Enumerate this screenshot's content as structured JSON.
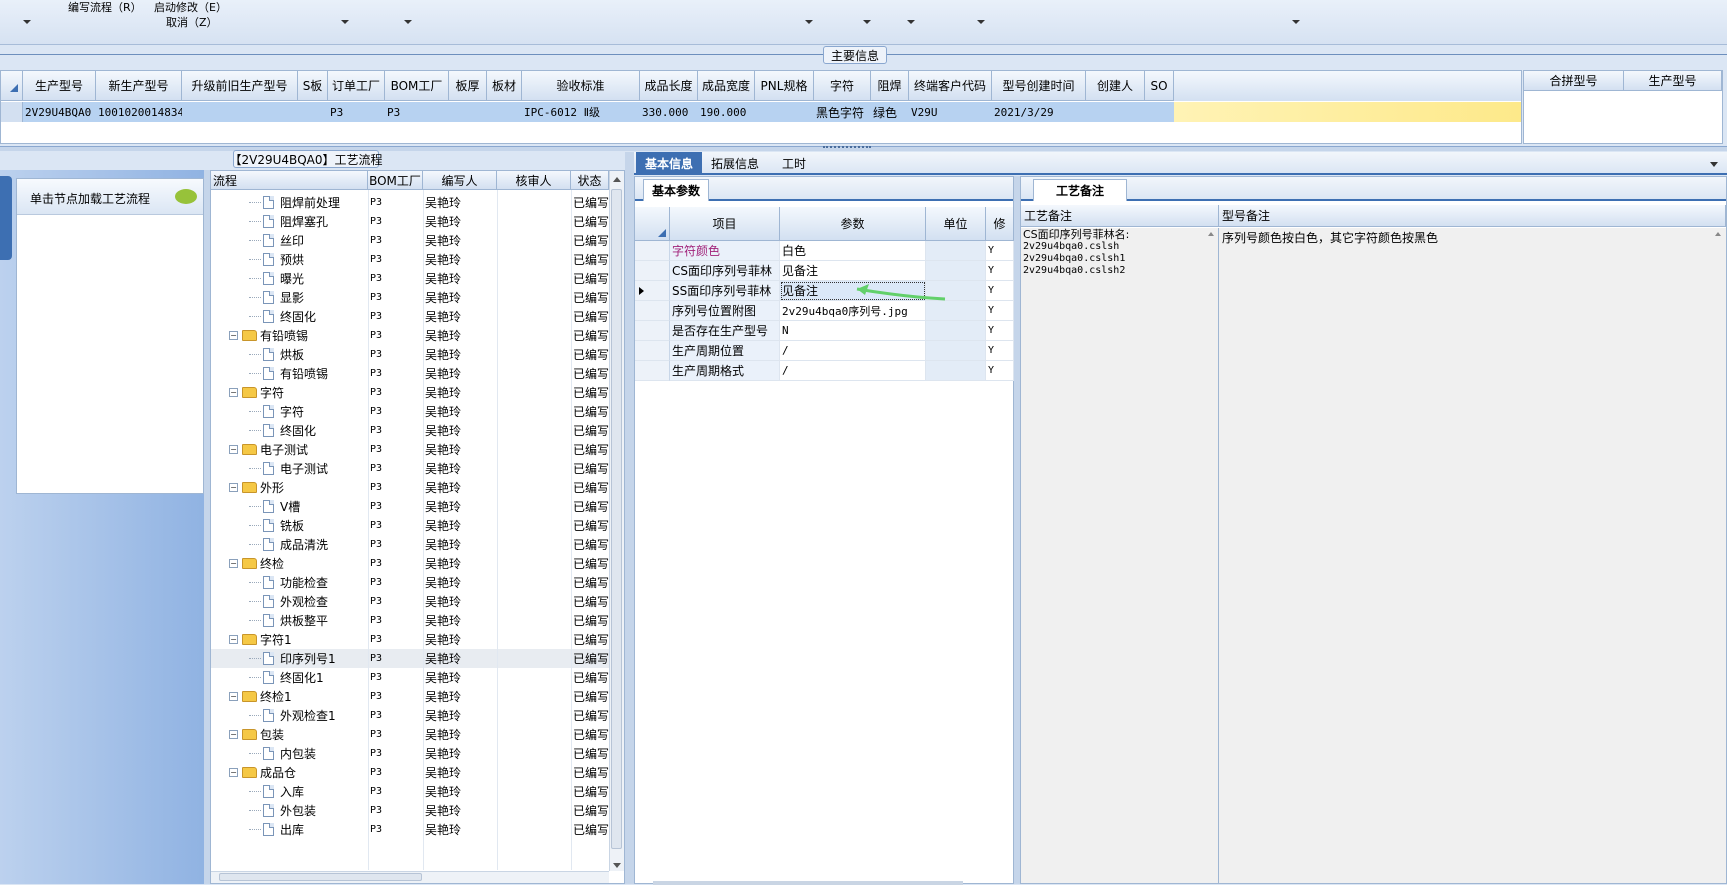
{
  "menu": {
    "edit_flow": "编写流程（R）",
    "start_modify": "启动修改（E）",
    "cancel": "取消（Z）"
  },
  "main_info_label": "主要信息",
  "main_grid": {
    "columns": [
      "生产型号",
      "新生产型号",
      "升级前旧生产型号",
      "S板",
      "订单工厂",
      "BOM工厂",
      "板厚",
      "板材",
      "验收标准",
      "成品长度",
      "成品宽度",
      "PNL规格",
      "字符",
      "阻焊",
      "终端客户代码",
      "型号创建时间",
      "创建人",
      "SO"
    ],
    "row": [
      "2V29U4BQA0",
      "10010200148343",
      "",
      "",
      "P3",
      "P3",
      "",
      "",
      "IPC-6012 Ⅱ级",
      "330.000",
      "190.000",
      "",
      "黑色字符",
      "绿色",
      "V29U",
      "2021/3/29",
      "",
      ""
    ]
  },
  "merge_grid": {
    "columns": [
      "合拼型号",
      "生产型号"
    ]
  },
  "left_panel": {
    "load_label": "单击节点加载工艺流程"
  },
  "flow_panel": {
    "title": "【2V29U4BQA0】工艺流程",
    "columns": [
      "流程",
      "BOM工厂",
      "编写人",
      "核审人",
      "状态"
    ],
    "rows": [
      {
        "type": "file",
        "name": "阻焊前处理",
        "bom": "P3",
        "writer": "吴艳玲",
        "reviewer": "",
        "status": "已编写"
      },
      {
        "type": "file",
        "name": "阻焊塞孔",
        "bom": "P3",
        "writer": "吴艳玲",
        "reviewer": "",
        "status": "已编写"
      },
      {
        "type": "file",
        "name": "丝印",
        "bom": "P3",
        "writer": "吴艳玲",
        "reviewer": "",
        "status": "已编写"
      },
      {
        "type": "file",
        "name": "预烘",
        "bom": "P3",
        "writer": "吴艳玲",
        "reviewer": "",
        "status": "已编写"
      },
      {
        "type": "file",
        "name": "曝光",
        "bom": "P3",
        "writer": "吴艳玲",
        "reviewer": "",
        "status": "已编写"
      },
      {
        "type": "file",
        "name": "显影",
        "bom": "P3",
        "writer": "吴艳玲",
        "reviewer": "",
        "status": "已编写"
      },
      {
        "type": "file",
        "name": "终固化",
        "bom": "P3",
        "writer": "吴艳玲",
        "reviewer": "",
        "status": "已编写"
      },
      {
        "type": "folder",
        "name": "有铅喷锡",
        "bom": "P3",
        "writer": "吴艳玲",
        "reviewer": "",
        "status": "已编写"
      },
      {
        "type": "file",
        "name": "烘板",
        "bom": "P3",
        "writer": "吴艳玲",
        "reviewer": "",
        "status": "已编写"
      },
      {
        "type": "file",
        "name": "有铅喷锡",
        "bom": "P3",
        "writer": "吴艳玲",
        "reviewer": "",
        "status": "已编写"
      },
      {
        "type": "folder",
        "name": "字符",
        "bom": "P3",
        "writer": "吴艳玲",
        "reviewer": "",
        "status": "已编写"
      },
      {
        "type": "file",
        "name": "字符",
        "bom": "P3",
        "writer": "吴艳玲",
        "reviewer": "",
        "status": "已编写"
      },
      {
        "type": "file",
        "name": "终固化",
        "bom": "P3",
        "writer": "吴艳玲",
        "reviewer": "",
        "status": "已编写"
      },
      {
        "type": "folder",
        "name": "电子测试",
        "bom": "P3",
        "writer": "吴艳玲",
        "reviewer": "",
        "status": "已编写"
      },
      {
        "type": "file",
        "name": "电子测试",
        "bom": "P3",
        "writer": "吴艳玲",
        "reviewer": "",
        "status": "已编写"
      },
      {
        "type": "folder",
        "name": "外形",
        "bom": "P3",
        "writer": "吴艳玲",
        "reviewer": "",
        "status": "已编写"
      },
      {
        "type": "file",
        "name": "V槽",
        "bom": "P3",
        "writer": "吴艳玲",
        "reviewer": "",
        "status": "已编写"
      },
      {
        "type": "file",
        "name": "铣板",
        "bom": "P3",
        "writer": "吴艳玲",
        "reviewer": "",
        "status": "已编写"
      },
      {
        "type": "file",
        "name": "成品清洗",
        "bom": "P3",
        "writer": "吴艳玲",
        "reviewer": "",
        "status": "已编写"
      },
      {
        "type": "folder",
        "name": "终检",
        "bom": "P3",
        "writer": "吴艳玲",
        "reviewer": "",
        "status": "已编写"
      },
      {
        "type": "file",
        "name": "功能检查",
        "bom": "P3",
        "writer": "吴艳玲",
        "reviewer": "",
        "status": "已编写"
      },
      {
        "type": "file",
        "name": "外观检查",
        "bom": "P3",
        "writer": "吴艳玲",
        "reviewer": "",
        "status": "已编写"
      },
      {
        "type": "file",
        "name": "烘板整平",
        "bom": "P3",
        "writer": "吴艳玲",
        "reviewer": "",
        "status": "已编写"
      },
      {
        "type": "folder",
        "name": "字符1",
        "bom": "P3",
        "writer": "吴艳玲",
        "reviewer": "",
        "status": "已编写"
      },
      {
        "type": "file",
        "name": "印序列号1",
        "bom": "P3",
        "writer": "吴艳玲",
        "reviewer": "",
        "status": "已编写",
        "selected": true
      },
      {
        "type": "file",
        "name": "终固化1",
        "bom": "P3",
        "writer": "吴艳玲",
        "reviewer": "",
        "status": "已编写"
      },
      {
        "type": "folder",
        "name": "终检1",
        "bom": "P3",
        "writer": "吴艳玲",
        "reviewer": "",
        "status": "已编写"
      },
      {
        "type": "file",
        "name": "外观检查1",
        "bom": "P3",
        "writer": "吴艳玲",
        "reviewer": "",
        "status": "已编写"
      },
      {
        "type": "folder",
        "name": "包装",
        "bom": "P3",
        "writer": "吴艳玲",
        "reviewer": "",
        "status": "已编写"
      },
      {
        "type": "file",
        "name": "内包装",
        "bom": "P3",
        "writer": "吴艳玲",
        "reviewer": "",
        "status": "已编写"
      },
      {
        "type": "folder",
        "name": "成品仓",
        "bom": "P3",
        "writer": "吴艳玲",
        "reviewer": "",
        "status": "已编写"
      },
      {
        "type": "file",
        "name": "入库",
        "bom": "P3",
        "writer": "吴艳玲",
        "reviewer": "",
        "status": "已编写"
      },
      {
        "type": "file",
        "name": "外包装",
        "bom": "P3",
        "writer": "吴艳玲",
        "reviewer": "",
        "status": "已编写"
      },
      {
        "type": "file",
        "name": "出库",
        "bom": "P3",
        "writer": "吴艳玲",
        "reviewer": "",
        "status": "已编写"
      }
    ]
  },
  "tabs": [
    "基本信息",
    "拓展信息",
    "工时"
  ],
  "params_panel": {
    "subtab": "基本参数",
    "columns": [
      "项目",
      "参数",
      "单位",
      "修"
    ],
    "rows": [
      {
        "item": "字符颜色",
        "value": "白色",
        "unit": "",
        "mod": "Y",
        "highlight": true
      },
      {
        "item": "CS面印序列号菲林",
        "value": "见备注",
        "unit": "",
        "mod": "Y"
      },
      {
        "item": "SS面印序列号菲林",
        "value": "见备注",
        "unit": "",
        "mod": "Y",
        "current": true
      },
      {
        "item": "序列号位置附图",
        "value": "2v29u4bqa0序列号.jpg",
        "unit": "",
        "mod": "Y"
      },
      {
        "item": "是否存在生产型号",
        "value": "N",
        "unit": "",
        "mod": "Y"
      },
      {
        "item": "生产周期位置",
        "value": "/",
        "unit": "",
        "mod": "Y"
      },
      {
        "item": "生产周期格式",
        "value": "/",
        "unit": "",
        "mod": "Y"
      }
    ]
  },
  "notes_panel": {
    "subtab": "工艺备注",
    "col1_header": "工艺备注",
    "col2_header": "型号备注",
    "process_note_lines": [
      "CS面印序列号菲林名:",
      "2v29u4bqa0.cslsh",
      "2v29u4bqa0.cslsh1",
      "2v29u4bqa0.cslsh2"
    ],
    "model_note": "序列号颜色按白色，其它字符颜色按黑色"
  },
  "colors": {
    "accent": "#3d6fb2",
    "row_selected": "#b7d2f1",
    "yellow": "#fde98a",
    "param_highlight": "#a1237a"
  }
}
